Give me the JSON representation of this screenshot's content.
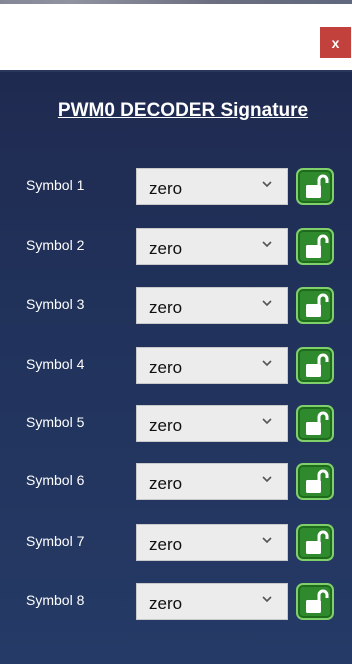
{
  "window": {
    "close_label": "x"
  },
  "panel": {
    "title": "PWM0  DECODER Signature"
  },
  "rows": [
    {
      "label": "Symbol 1",
      "value": "zero"
    },
    {
      "label": "Symbol 2",
      "value": "zero"
    },
    {
      "label": "Symbol 3",
      "value": "zero"
    },
    {
      "label": "Symbol 4",
      "value": "zero"
    },
    {
      "label": "Symbol 5",
      "value": "zero"
    },
    {
      "label": "Symbol 6",
      "value": "zero"
    },
    {
      "label": "Symbol 7",
      "value": "zero"
    },
    {
      "label": "Symbol 8",
      "value": "zero"
    }
  ],
  "icons": {
    "dropdown": "chevron-down-icon",
    "lock": "unlocked-padlock-icon"
  },
  "colors": {
    "panel_background": "#21335c",
    "close_button": "#c2413c",
    "lock_button": "#2f8a2d"
  }
}
